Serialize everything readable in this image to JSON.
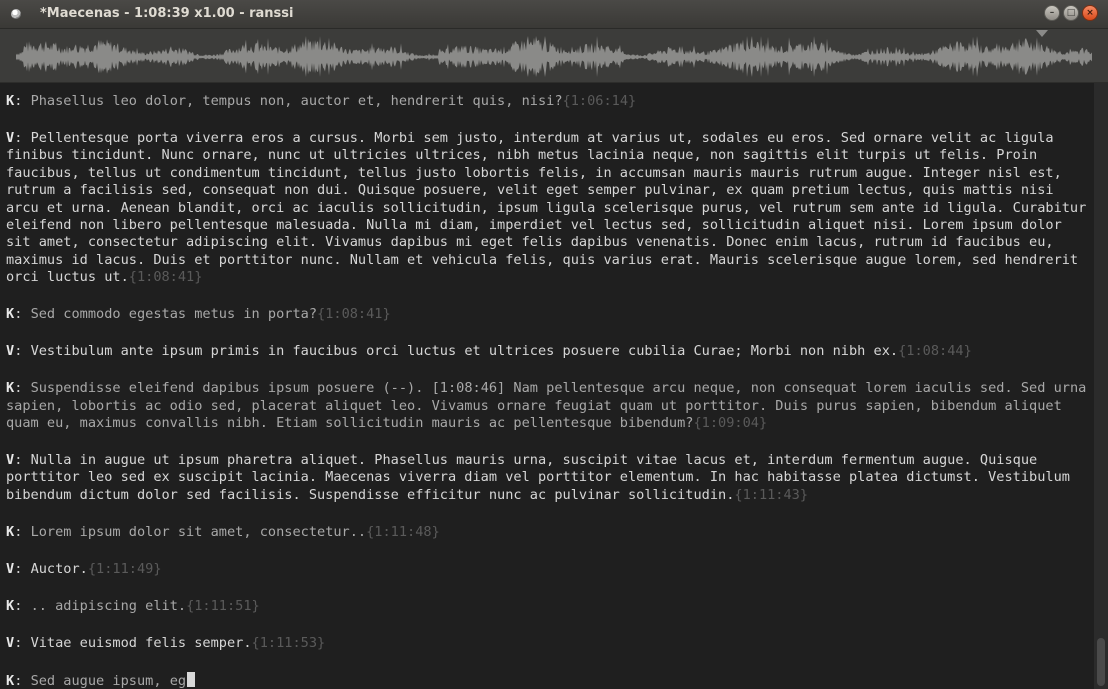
{
  "window": {
    "title": "*Maecenas - 1:08:39 x1.00 - ranssi"
  },
  "icons": {
    "app": "app-icon",
    "minimize": "minimize-icon",
    "maximize": "maximize-icon",
    "close": "close-icon",
    "playhead": "playhead-marker-icon"
  },
  "window_buttons": {
    "minimize": "–",
    "maximize": "□",
    "close": "×"
  },
  "colors": {
    "background": "#1f1f1f",
    "titlebar": "#3c3b37",
    "waveform": "#8a8a88",
    "timestamp": "#5a5a5a",
    "close": "#e05a28"
  },
  "transcript": [
    {
      "speaker": "K",
      "sep": ": ",
      "text": "Phasellus leo dolor, tempus non, auctor et, hendrerit quis, nisi?",
      "ts": "{1:06:14}"
    },
    {
      "speaker": "V",
      "sep": ": ",
      "text": "Pellentesque porta viverra eros a cursus. Morbi sem justo, interdum at varius ut, sodales eu eros. Sed ornare velit ac ligula finibus tincidunt. Nunc ornare, nunc ut ultricies ultrices, nibh metus lacinia neque, non sagittis elit turpis ut felis. Proin faucibus, tellus ut condimentum tincidunt, tellus justo lobortis felis, in accumsan mauris mauris rutrum augue. Integer nisl est, rutrum a facilisis sed, consequat non dui. Quisque posuere, velit eget semper pulvinar, ex quam pretium lectus, quis mattis nisi arcu et urna. Aenean blandit, orci ac iaculis sollicitudin, ipsum ligula scelerisque purus, vel rutrum sem ante id ligula. Curabitur eleifend non libero pellentesque malesuada. Nulla mi diam, imperdiet vel lectus sed, sollicitudin aliquet nisi. Lorem ipsum dolor sit amet, consectetur adipiscing elit. Vivamus dapibus mi eget felis dapibus venenatis. Donec enim lacus, rutrum id faucibus eu, maximus id lacus. Duis et porttitor nunc. Nullam et vehicula felis, quis varius erat. Mauris scelerisque augue lorem, sed hendrerit orci luctus ut.",
      "ts": "{1:08:41}"
    },
    {
      "speaker": "K",
      "sep": ": ",
      "text": "Sed commodo egestas metus in porta?",
      "ts": "{1:08:41}"
    },
    {
      "speaker": "V",
      "sep": ": ",
      "text": "Vestibulum ante ipsum primis in faucibus orci luctus et ultrices posuere cubilia Curae; Morbi non nibh ex.",
      "ts": "{1:08:44}"
    },
    {
      "speaker": "K",
      "sep": ": ",
      "text": "Suspendisse eleifend dapibus ipsum posuere (--). [1:08:46] Nam pellentesque arcu neque, non consequat lorem iaculis sed. Sed urna sapien, lobortis ac odio sed, placerat aliquet leo. Vivamus ornare feugiat quam ut porttitor. Duis purus sapien, bibendum aliquet quam eu, maximus convallis nibh. Etiam sollicitudin mauris ac pellentesque bibendum?",
      "ts": "{1:09:04}"
    },
    {
      "speaker": "V",
      "sep": ": ",
      "text": "Nulla in augue ut ipsum pharetra aliquet. Phasellus mauris urna, suscipit vitae lacus et, interdum fermentum augue. Quisque porttitor leo sed ex suscipit lacinia. Maecenas viverra diam vel porttitor elementum. In hac habitasse platea dictumst. Vestibulum bibendum dictum dolor sed facilisis. Suspendisse efficitur nunc ac pulvinar sollicitudin.",
      "ts": "{1:11:43}"
    },
    {
      "speaker": "K",
      "sep": ": ",
      "text": "Lorem ipsum dolor sit amet, consectetur..",
      "ts": "{1:11:48}"
    },
    {
      "speaker": "V",
      "sep": ": ",
      "text": "Auctor.",
      "ts": "{1:11:49}"
    },
    {
      "speaker": "K",
      "sep": ": ",
      "text": ".. adipiscing elit.",
      "ts": "{1:11:51}"
    },
    {
      "speaker": "V",
      "sep": ": ",
      "text": "Vitae euismod felis semper.",
      "ts": "{1:11:53}"
    },
    {
      "speaker": "K",
      "sep": ": ",
      "text": "Sed augue ipsum, eg",
      "ts": ""
    }
  ]
}
